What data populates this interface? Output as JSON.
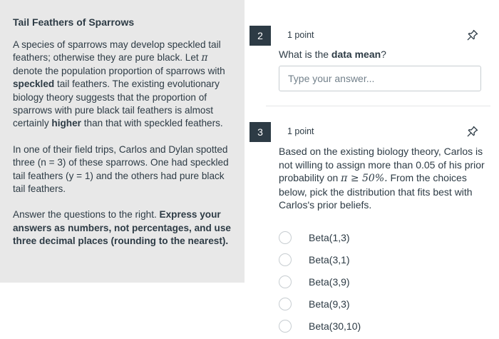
{
  "left_panel": {
    "title": "Tail Feathers of Sparrows",
    "p1_a": "A species of sparrows may develop speckled tail feathers; otherwise they are pure black. Let ",
    "p1_pi": "π",
    "p1_b": " denote the population proportion of sparrows with ",
    "p1_bold1": "speckled",
    "p1_c": " tail feathers. The existing evolutionary biology theory suggests that the proportion of sparrows with pure black tail feathers is almost certainly ",
    "p1_bold2": "higher",
    "p1_d": " than that with speckled feathers.",
    "p2": "In one of their field trips, Carlos and Dylan spotted three (n = 3) of these sparrows. One had speckled tail feathers (y = 1) and the others had pure black tail feathers.",
    "p3_a": "Answer the questions to the right. ",
    "p3_bold": "Express your answers as numbers, not percentages, and use three decimal places (rounding to the nearest)."
  },
  "question2": {
    "number": "2",
    "points": "1 point",
    "text_a": "What is the ",
    "text_bold": "data mean",
    "text_b": "?",
    "placeholder": "Type your answer..."
  },
  "question3": {
    "number": "3",
    "points": "1 point",
    "text_a": "Based on the existing biology theory, Carlos is not willing to assign more than 0.05 of his prior probability on ",
    "math": "π ≥ 50%.",
    "text_b": " From the choices below, pick the distribution that fits best with Carlos's prior beliefs.",
    "options": [
      "Beta(1,3)",
      "Beta(3,1)",
      "Beta(3,9)",
      "Beta(9,3)",
      "Beta(30,10)"
    ]
  },
  "icons": {
    "pin": "pin-icon"
  }
}
